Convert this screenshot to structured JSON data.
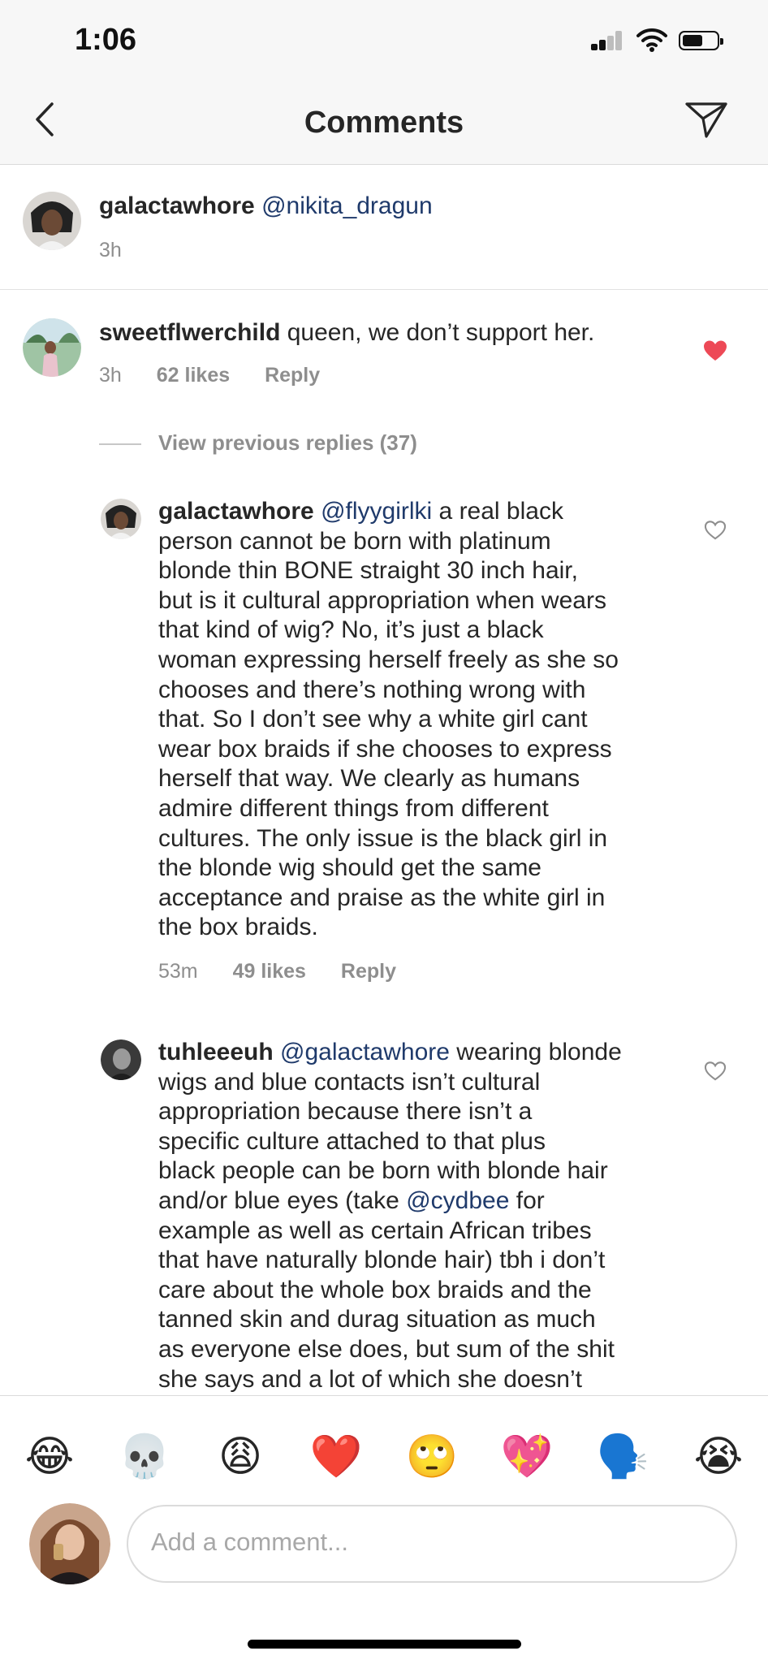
{
  "status_bar": {
    "time": "1:06"
  },
  "header": {
    "title": "Comments"
  },
  "caption": {
    "username": "galactawhore",
    "mention": "@nikita_dragun",
    "time": "3h"
  },
  "comment_1": {
    "username": "sweetflwerchild",
    "text": "queen, we don’t support her.",
    "time": "3h",
    "likes": "62 likes",
    "reply": "Reply",
    "liked": true
  },
  "view_previous": "View previous replies (37)",
  "reply_1": {
    "username": "galactawhore",
    "mention": "@flyygirlki",
    "lines": [
      "a real black",
      "person cannot be born with platinum",
      "blonde thin BONE straight 30 inch hair,",
      "but is it cultural appropriation when wears",
      "that kind of wig? No, it’s just a black",
      "woman expressing herself freely as she so",
      "chooses and there’s nothing wrong with",
      "that. So I don’t see why a white girl cant",
      "wear box braids if she chooses to express",
      "herself that way. We clearly as humans",
      "admire different things from different",
      "cultures. The only issue is the black girl in",
      "the blonde wig should get the same",
      "acceptance and praise as the white girl in",
      "the box braids."
    ],
    "time": "53m",
    "likes": "49 likes",
    "reply": "Reply"
  },
  "reply_2": {
    "username": "tuhleeeuh",
    "mention": "@galactawhore",
    "line_1_rest": "wearing blonde",
    "lines_a": [
      "wigs and blue contacts isn’t cultural",
      "appropriation because there isn’t a",
      "specific culture attached to that plus",
      "black people can be born with blonde hair"
    ],
    "line_6_pre": "and/or blue eyes (take",
    "line_6_mention": "@cydbee",
    "line_6_post": "for",
    "lines_b": [
      "example as well as certain African tribes",
      "that have naturally blonde hair) tbh i don’t",
      "care about the whole box braids and the",
      "tanned skin and durag situation as much",
      "as everyone else does, but sum of the shit",
      "she says and a lot of which she doesn’t"
    ]
  },
  "emoji_bar": [
    "😂",
    "💀",
    "😩",
    "❤️",
    "🙄",
    "💖",
    "🗣️",
    "😭"
  ],
  "comment_input": {
    "placeholder": "Add a comment..."
  }
}
